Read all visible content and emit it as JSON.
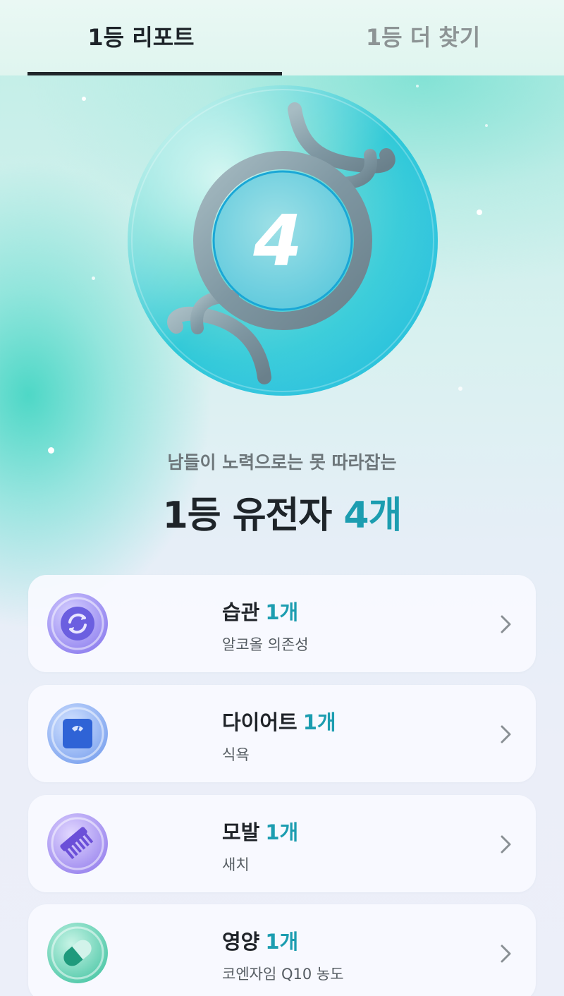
{
  "tabs": [
    {
      "label": "1등 리포트",
      "active": true
    },
    {
      "label": "1등 더 찾기",
      "active": false
    }
  ],
  "hero": {
    "badge_number": "4",
    "subtitle": "남들이 노력으로는 못 따라잡는",
    "headline_main": "1등 유전자",
    "headline_count": "4개"
  },
  "categories": [
    {
      "title": "습관",
      "count": "1개",
      "detail": "알코올 의존성",
      "icon": "cycle-icon",
      "icon_color": "#6b5fe0"
    },
    {
      "title": "다이어트",
      "count": "1개",
      "detail": "식욕",
      "icon": "scale-icon",
      "icon_color": "#2f63d6"
    },
    {
      "title": "모발",
      "count": "1개",
      "detail": "새치",
      "icon": "comb-icon",
      "icon_color": "#7a5fe0"
    },
    {
      "title": "영양",
      "count": "1개",
      "detail": "코엔자임 Q10 농도",
      "icon": "pill-icon",
      "icon_color": "#2aa889"
    }
  ],
  "colors": {
    "accent": "#1c9db0",
    "text_primary": "#1e2429",
    "tab_inactive": "#8d9495"
  }
}
